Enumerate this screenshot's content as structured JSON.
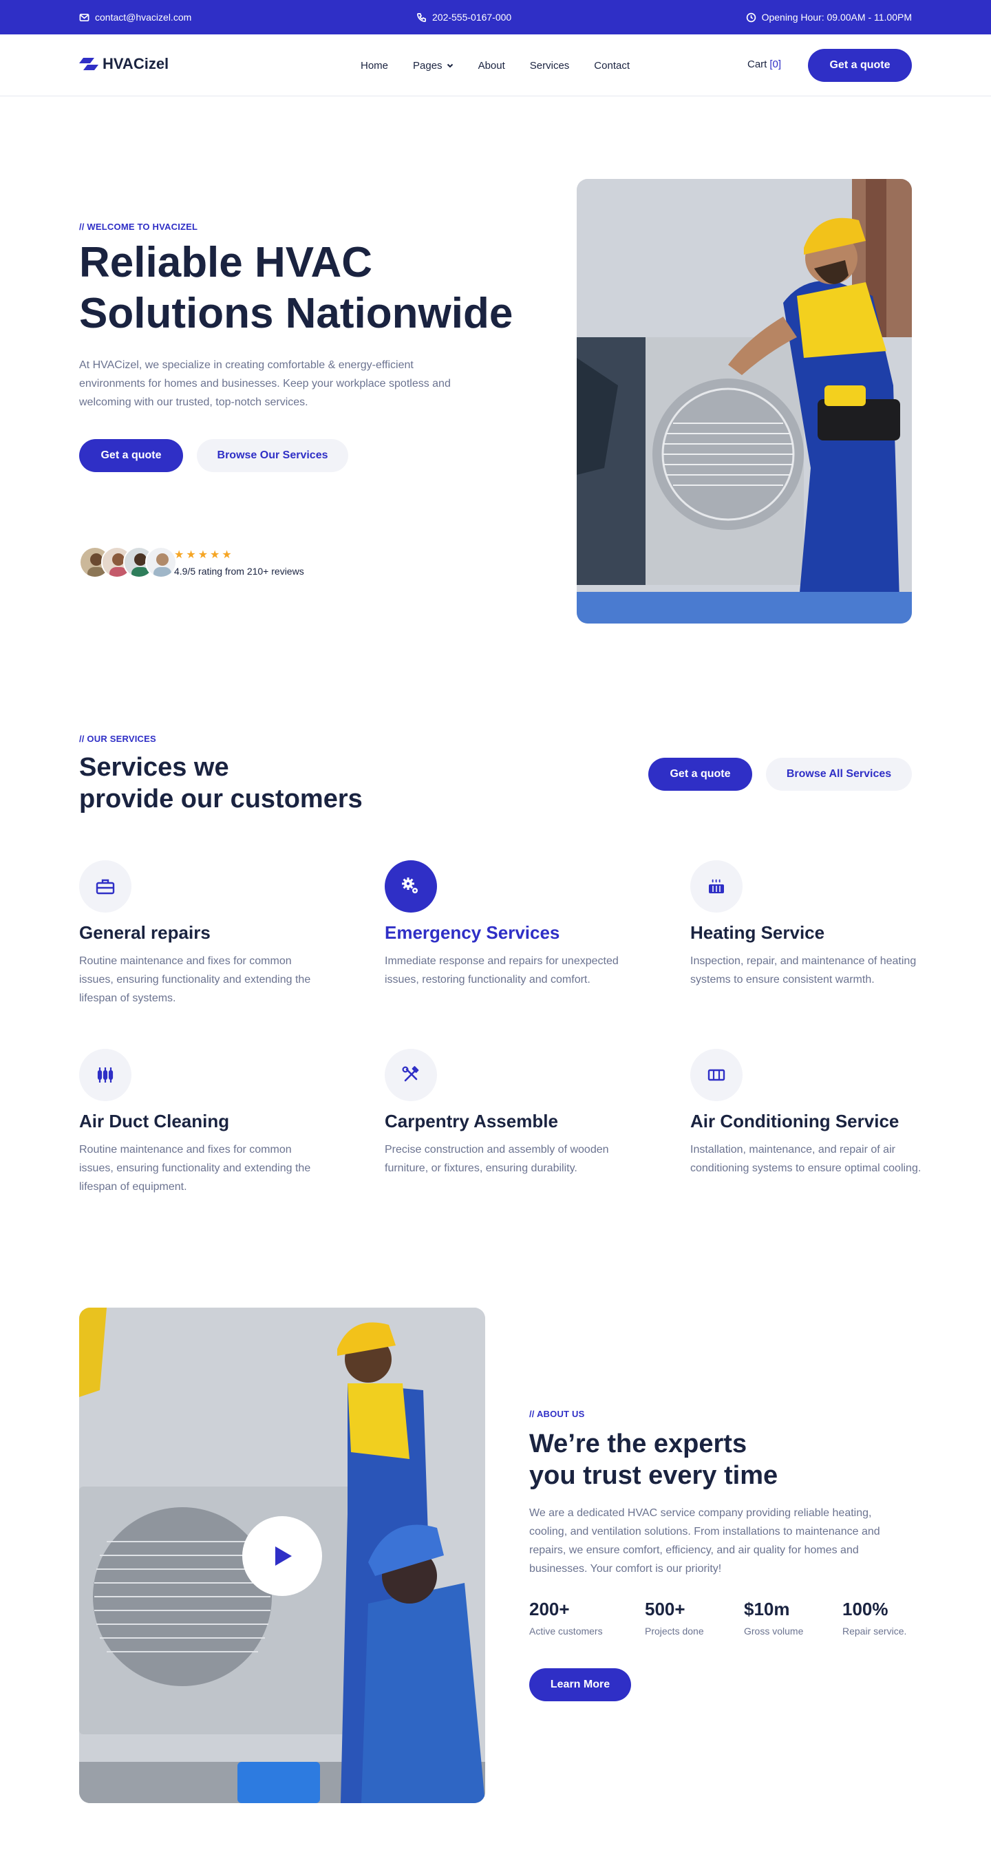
{
  "topbar": {
    "email": "contact@hvacizel.com",
    "phone": "202-555-0167-000",
    "hours": "Opening Hour: 09.00AM - 11.00PM"
  },
  "header": {
    "logo": "HVACizel",
    "nav": [
      "Home",
      "Pages",
      "About",
      "Services",
      "Contact"
    ],
    "cart_label": "Cart",
    "cart_count": "[0]",
    "quote_label": "Get a quote"
  },
  "hero": {
    "eyebrow": "// WELCOME TO HVACIZEL",
    "title": "Reliable HVAC Solutions Nationwide",
    "description": "At HVACizel, we specialize in creating comfortable & energy-efficient environments for homes and businesses. Keep your workplace spotless  and welcoming with our trusted, top-notch services.",
    "btn_quote": "Get a quote",
    "btn_browse": "Browse Our Services",
    "stars": "★★★★★",
    "rating_text": "4.9/5 rating from 210+ reviews"
  },
  "services": {
    "eyebrow": "// OUR SERVICES",
    "title_line1": "Services we",
    "title_line2": "provide our customers",
    "btn_quote": "Get a quote",
    "btn_browse": "Browse All Services",
    "items": [
      {
        "name": "General repairs",
        "desc": "Routine maintenance and fixes for common issues, ensuring functionality and extending the lifespan of systems.",
        "icon": "toolbox-icon"
      },
      {
        "name": "Emergency Services",
        "desc": "Immediate response and repairs for unexpected issues, restoring functionality and comfort.",
        "icon": "gears-icon"
      },
      {
        "name": "Heating Service",
        "desc": "Inspection, repair, and maintenance of heating systems to ensure consistent warmth.",
        "icon": "radiator-icon"
      },
      {
        "name": "Air Duct Cleaning",
        "desc": "Routine maintenance and fixes for common issues, ensuring functionality and extending the lifespan of equipment.",
        "icon": "filters-icon"
      },
      {
        "name": "Carpentry Assemble",
        "desc": "Precise construction and assembly of wooden furniture, or fixtures, ensuring durability.",
        "icon": "tools-icon"
      },
      {
        "name": "Air Conditioning Service",
        "desc": "Installation, maintenance, and repair of air conditioning systems to ensure optimal cooling.",
        "icon": "ac-unit-icon"
      }
    ]
  },
  "about": {
    "eyebrow": "// ABOUT US",
    "title": "We’re the experts\n you trust every time",
    "description": "We are a dedicated HVAC service company providing reliable heating, cooling, and ventilation solutions. From installations to maintenance and repairs, we ensure comfort, efficiency, and air quality for homes and businesses. Your comfort is our priority!",
    "stats": [
      {
        "value": "200+",
        "label": "Active customers"
      },
      {
        "value": "500+",
        "label": "Projects done"
      },
      {
        "value": "$10m",
        "label": "Gross volume"
      },
      {
        "value": "100%",
        "label": "Repair service."
      }
    ],
    "btn": "Learn More"
  },
  "colors": {
    "primary": "#2f2fc6",
    "heading": "#1a2340",
    "muted": "#6b7390",
    "star": "#f5a524"
  }
}
